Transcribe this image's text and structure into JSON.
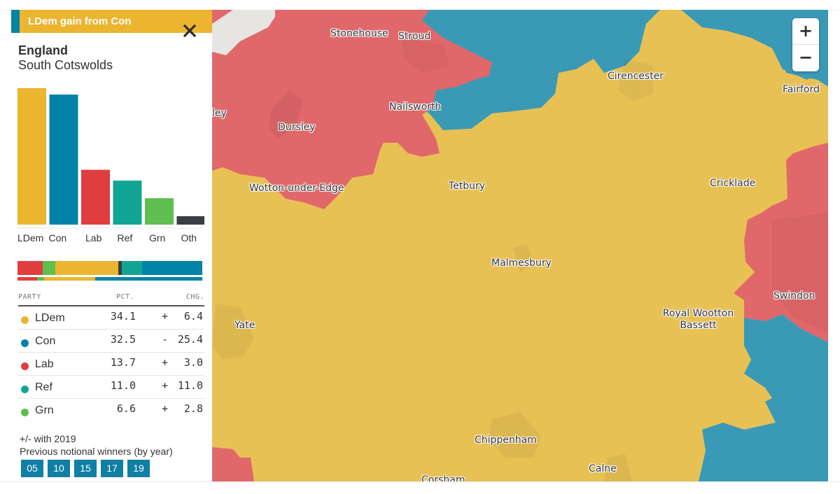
{
  "result": {
    "banner": "LDem gain from Con",
    "winner_color": "#ebb530",
    "previous_color": "#0083a6",
    "region": "England",
    "constituency": "South Cotswolds"
  },
  "chart_data": {
    "type": "bar",
    "title": "",
    "categories": [
      "LDem",
      "Con",
      "Lab",
      "Ref",
      "Grn",
      "Oth"
    ],
    "values": [
      34.1,
      32.5,
      13.7,
      11.0,
      6.6,
      2.1
    ],
    "colors": [
      "#ebb530",
      "#0083a6",
      "#e03e3e",
      "#13a594",
      "#5ebe4f",
      "#3a3d42"
    ],
    "xlabel": "",
    "ylabel": "",
    "ylim": [
      0,
      34.1
    ],
    "grid": false
  },
  "share_bars": {
    "current": [
      {
        "party": "Lab",
        "value": 13.7,
        "color": "#e03e3e"
      },
      {
        "party": "Grn",
        "value": 6.6,
        "color": "#5ebe4f"
      },
      {
        "party": "LDem",
        "value": 34.1,
        "color": "#ebb530"
      },
      {
        "party": "Oth",
        "value": 2.1,
        "color": "#3a3d42"
      },
      {
        "party": "Ref",
        "value": 11.0,
        "color": "#13a594"
      },
      {
        "party": "Con",
        "value": 32.5,
        "color": "#0083a6"
      }
    ],
    "previous": [
      {
        "party": "Lab",
        "value": 10.7,
        "color": "#e03e3e"
      },
      {
        "party": "Grn",
        "value": 3.8,
        "color": "#5ebe4f"
      },
      {
        "party": "LDem",
        "value": 27.7,
        "color": "#ebb530"
      },
      {
        "party": "Con",
        "value": 57.9,
        "color": "#0083a6"
      }
    ]
  },
  "table": {
    "headers": {
      "party": "PARTY",
      "pct": "PCT.",
      "chg": "CHG."
    },
    "rows": [
      {
        "party": "LDem",
        "color": "#ebb530",
        "pct": "34.1",
        "sign": "+",
        "chg": "6.4"
      },
      {
        "party": "Con",
        "color": "#0083a6",
        "pct": "32.5",
        "sign": "-",
        "chg": "25.4"
      },
      {
        "party": "Lab",
        "color": "#e03e3e",
        "pct": "13.7",
        "sign": "+",
        "chg": "3.0"
      },
      {
        "party": "Ref",
        "color": "#13a594",
        "pct": "11.0",
        "sign": "+",
        "chg": "11.0"
      },
      {
        "party": "Grn",
        "color": "#5ebe4f",
        "pct": "6.6",
        "sign": "+",
        "chg": "2.8"
      }
    ]
  },
  "notes": {
    "change_basis": "+/- with 2019",
    "previous_winners_label": "Previous notional winners (by year)"
  },
  "previous_years": [
    "05",
    "10",
    "15",
    "17",
    "19"
  ],
  "map": {
    "zoom_in": "+",
    "zoom_out": "−",
    "colors": {
      "ldem": "#e8c155",
      "con": "#3a9ab6",
      "lab": "#e0686a",
      "water": "#e6e5e1"
    },
    "places": [
      "Stonehouse",
      "Stroud",
      "Cirencester",
      "Fairford",
      "Nailsworth",
      "ley",
      "Dursley",
      "Wotton-under-Edge",
      "Tetbury",
      "Cricklade",
      "Malmesbury",
      "Swindon",
      "Royal Wootton Bassett",
      "Yate",
      "Chippenham",
      "Calne",
      "Corsham"
    ]
  }
}
